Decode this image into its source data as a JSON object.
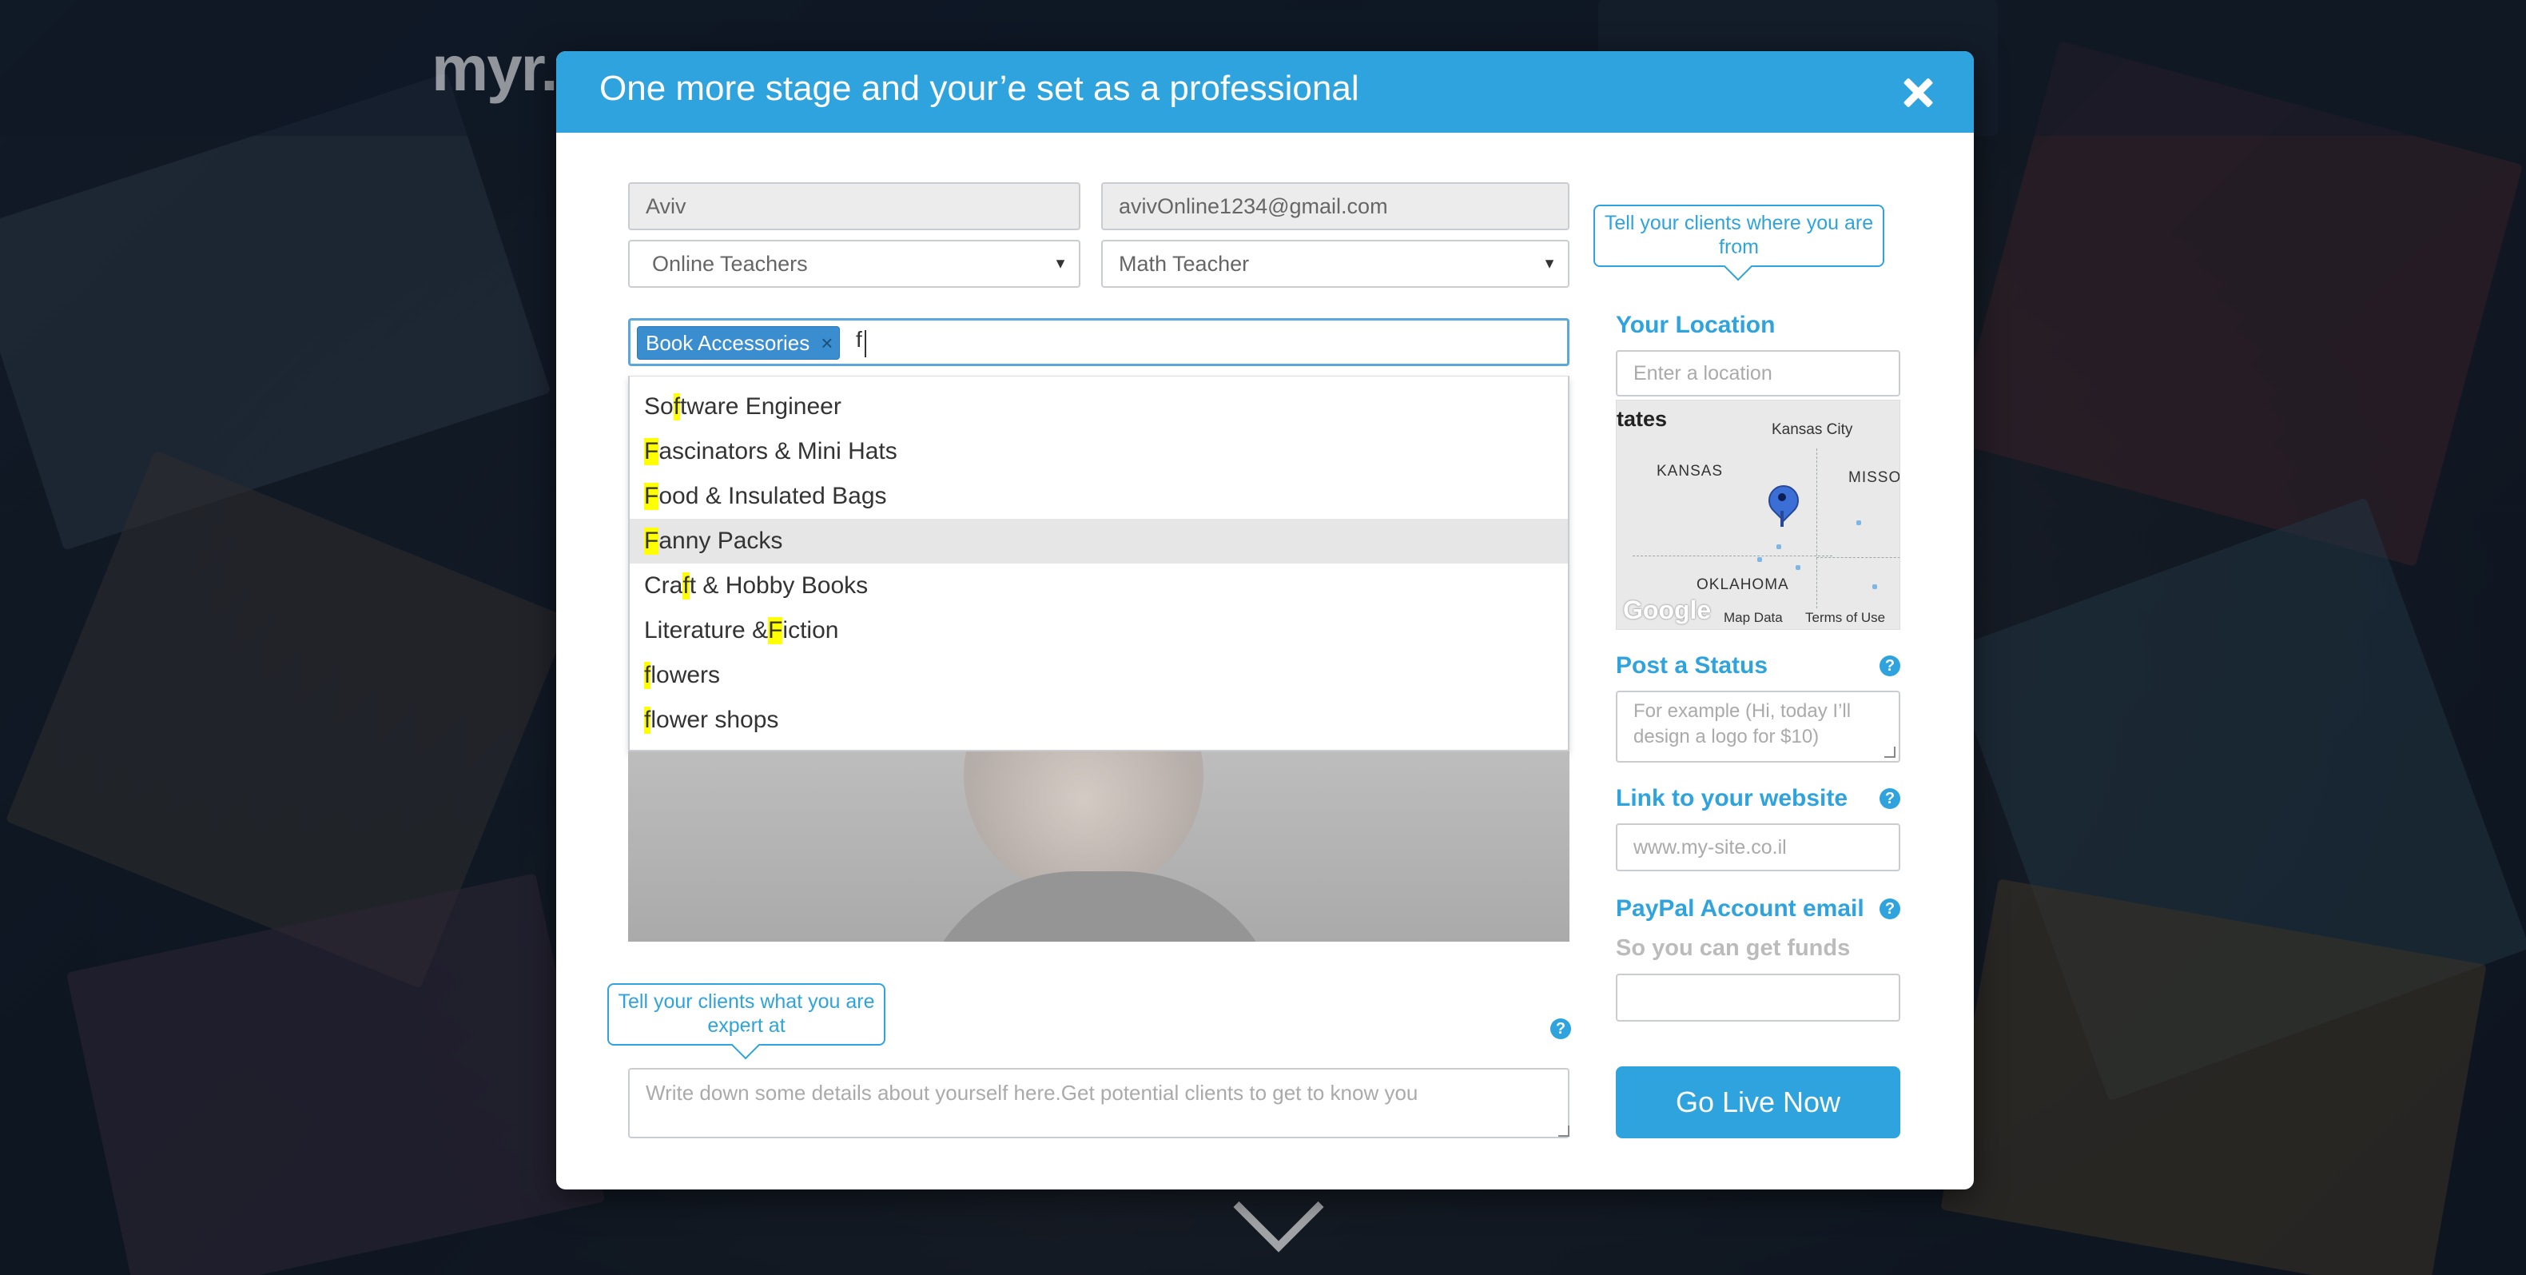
{
  "background": {
    "logo_text": "myr..."
  },
  "modal": {
    "title": "One more stage and your’e set as a professional",
    "name_value": "Aviv",
    "email_value": "avivOnline1234@gmail.com",
    "category_select": "Online Teachers",
    "profession_select": "Math Teacher",
    "tags": [
      "Book Accessories"
    ],
    "tag_remove_glyph": "×",
    "typed_query": "f",
    "suggestions": [
      {
        "pre": "So",
        "hl": "f",
        "post": "tware Engineer",
        "active": false
      },
      {
        "pre": "",
        "hl": "F",
        "post": "ascinators & Mini Hats",
        "active": false
      },
      {
        "pre": "",
        "hl": "F",
        "post": "ood & Insulated Bags",
        "active": false
      },
      {
        "pre": "",
        "hl": "F",
        "post": "anny Packs",
        "active": true
      },
      {
        "pre": "Cra",
        "hl": "f",
        "post": "t & Hobby Books",
        "active": false
      },
      {
        "pre": "Literature & ",
        "hl": "F",
        "post": "iction",
        "active": false
      },
      {
        "pre": "",
        "hl": "f",
        "post": "lowers",
        "active": false
      },
      {
        "pre": "",
        "hl": "f",
        "post": "lower shops",
        "active": false
      }
    ],
    "callout_location": "Tell your clients where you are from",
    "callout_expertise": "Tell your clients what you are expert at",
    "about_placeholder": "Write down some details about yourself here.Get potential clients to get to know you",
    "location_label": "Your Location",
    "location_placeholder": "Enter a location",
    "map": {
      "labels": {
        "states": "tates",
        "kansas_city": "Kansas City",
        "kansas": "KANSAS",
        "missouri": "MISSOU",
        "oklahoma": "OKLAHOMA"
      },
      "google": "Google",
      "map_data": "Map Data",
      "terms": "Terms of Use"
    },
    "status_label": "Post a Status",
    "status_placeholder": "For example (Hi, today I’ll design a logo for $10)",
    "website_label": "Link to your website",
    "website_placeholder": "www.my-site.co.il",
    "paypal_label": "PayPal Account email",
    "paypal_sub": "So you can get funds",
    "paypal_value": "",
    "help_glyph": "?",
    "go_live": "Go Live Now"
  },
  "colors": {
    "accent": "#2ea3dd",
    "highlight": "#ffff00",
    "tag": "#3a8ed0"
  }
}
